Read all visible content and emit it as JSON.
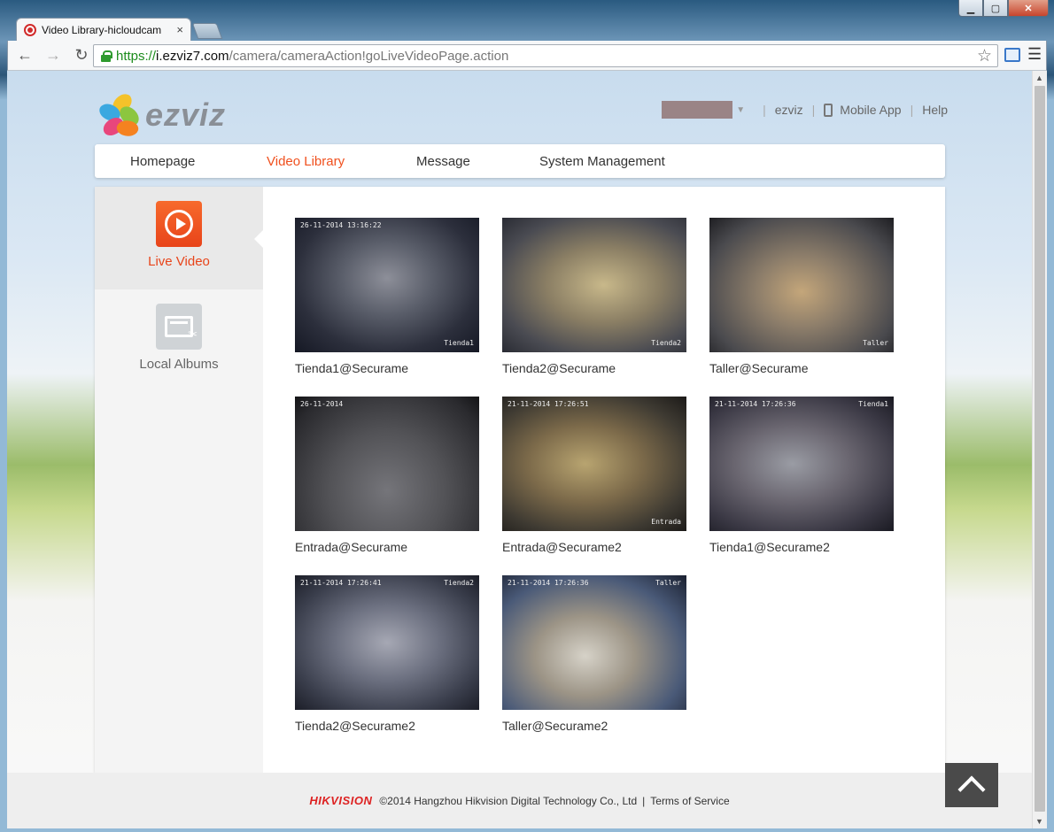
{
  "window": {
    "min": "▁",
    "max": "▢",
    "close": "✕"
  },
  "tab": {
    "title": "Video Library-hicloudcam",
    "close": "×"
  },
  "toolbar": {
    "back": "←",
    "forward": "→",
    "reload": "↻",
    "url_scheme": "https://",
    "url_host": "i.ezviz7.com",
    "url_path": "/camera/cameraAction!goLiveVideoPage.action",
    "star": "☆",
    "menu": "☰"
  },
  "logo": {
    "text": "ezviz"
  },
  "user_bar": {
    "caret": "▼",
    "sep": "|",
    "ezviz": "ezviz",
    "mobile_app": "Mobile App",
    "help": "Help"
  },
  "nav": {
    "homepage": "Homepage",
    "video_library": "Video Library",
    "message": "Message",
    "system_management": "System Management"
  },
  "sidebar": {
    "live_video": "Live Video",
    "local_albums": "Local Albums"
  },
  "cameras": [
    {
      "name": "Tienda1@Securame",
      "timestamp": "26-11-2014 13:16:22",
      "tag": "Tienda1",
      "tag_pos": "bottom"
    },
    {
      "name": "Tienda2@Securame",
      "timestamp": "",
      "tag": "Tienda2",
      "tag_pos": "bottom"
    },
    {
      "name": "Taller@Securame",
      "timestamp": "",
      "tag": "Taller",
      "tag_pos": "bottom"
    },
    {
      "name": "Entrada@Securame",
      "timestamp": "26-11-2014",
      "tag": "",
      "tag_pos": "bottom"
    },
    {
      "name": "Entrada@Securame2",
      "timestamp": "21-11-2014 17:26:51",
      "tag": "Entrada",
      "tag_pos": "bottom"
    },
    {
      "name": "Tienda1@Securame2",
      "timestamp": "21-11-2014 17:26:36",
      "tag": "Tienda1",
      "tag_pos": "top"
    },
    {
      "name": "Tienda2@Securame2",
      "timestamp": "21-11-2014 17:26:41",
      "tag": "Tienda2",
      "tag_pos": "top"
    },
    {
      "name": "Taller@Securame2",
      "timestamp": "21-11-2014 17:26:36",
      "tag": "Taller",
      "tag_pos": "top"
    }
  ],
  "footer": {
    "brand": "HIKVISION",
    "copyright": "©2014 Hangzhou Hikvision Digital Technology Co., Ltd",
    "divider": "|",
    "terms": "Terms of Service"
  },
  "colors": {
    "accent": "#f0501e",
    "brand_red": "#dd2222"
  }
}
